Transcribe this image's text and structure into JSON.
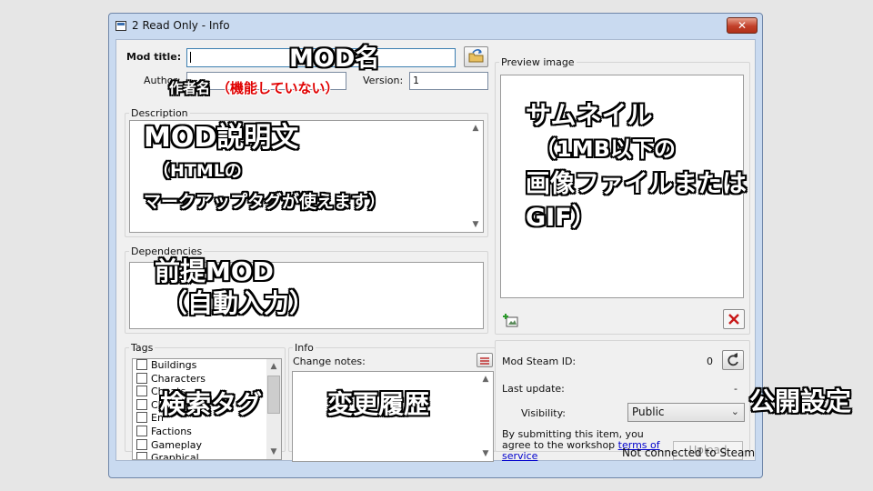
{
  "window": {
    "title": "2 Read Only - Info",
    "close_glyph": "✕"
  },
  "form": {
    "mod_title_label": "Mod title:",
    "author_label": "Author:",
    "version_label": "Version:",
    "version_value": "1",
    "description_label": "Description",
    "dependencies_label": "Dependencies",
    "preview_label": "Preview image",
    "tags_label": "Tags",
    "info_label": "Info",
    "change_notes_label": "Change notes:"
  },
  "tags": [
    "Buildings",
    "Characters",
    "Cheats",
    "Cl",
    "En",
    "Factions",
    "Gameplay",
    "Graphical"
  ],
  "steam": {
    "mod_id_label": "Mod Steam ID:",
    "mod_id_value": "0",
    "last_update_label": "Last update:",
    "last_update_value": "-",
    "visibility_label": "Visibility:",
    "visibility_value": "Public",
    "agree_text_1": "By submitting this item, you",
    "agree_text_2": "agree to the workshop",
    "terms_1": "terms of",
    "terms_2": "service",
    "upload_label": "Upload"
  },
  "status": {
    "text": "Not connected to Steam"
  },
  "annotations": {
    "mod_name": "MOD名",
    "author_name": "作者名",
    "author_note": "（機能していない）",
    "desc_line1": "MOD説明文",
    "desc_line2": "（HTMLの",
    "desc_line3": "マークアップタグが使えます）",
    "preview_line1": "サムネイル",
    "preview_line2": "（1MB以下の",
    "preview_line3": "画像ファイルまたは",
    "preview_line4": "GIF）",
    "deps_line1": "前提MOD",
    "deps_line2": "（自動入力）",
    "tags": "検索タグ",
    "history": "変更履歴",
    "visibility": "公開設定"
  },
  "colors": {
    "title_bg": "#c9daf0",
    "client_bg": "#f0f0f0",
    "link": "#0000cc",
    "close_red": "#c2402a"
  },
  "icons": [
    "window-app-icon",
    "close-icon",
    "folder-browse-icon",
    "add-image-icon",
    "delete-x-icon",
    "change-notes-icon",
    "refresh-icon",
    "chevron-down-icon"
  ]
}
